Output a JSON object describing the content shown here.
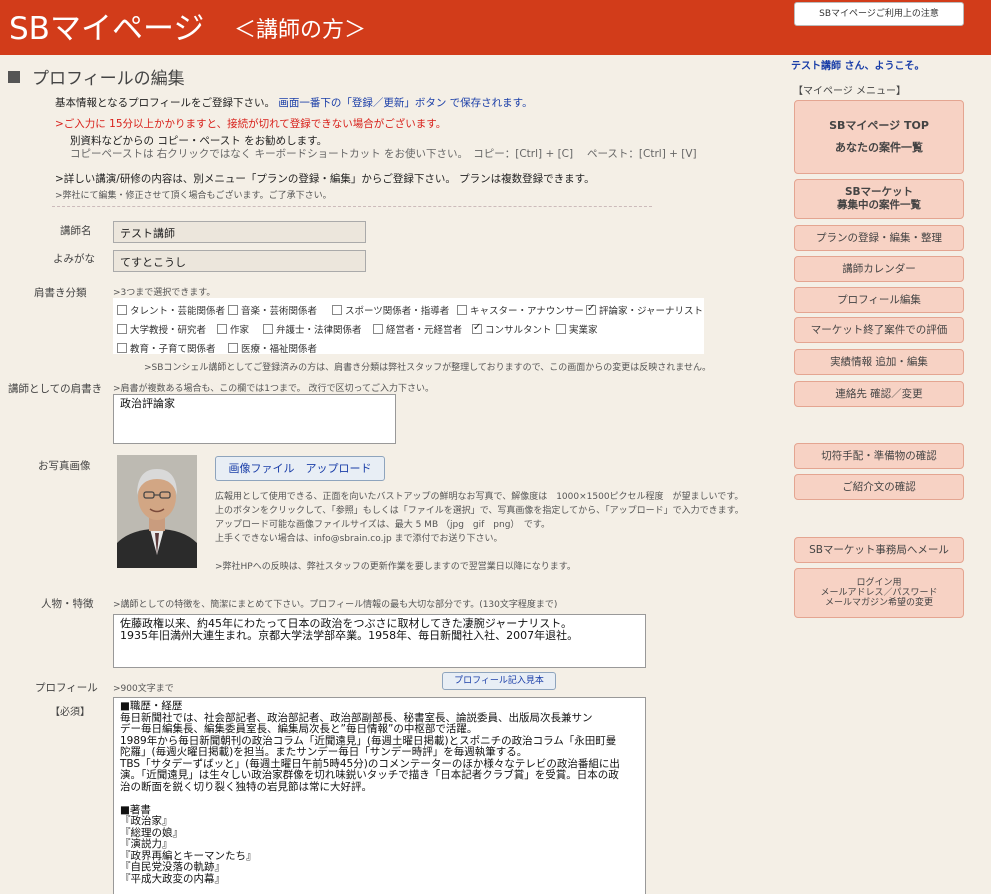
{
  "header": {
    "title": "SBマイページ",
    "subtitle": "＜講師の方＞",
    "notice_button": "SBマイページご利用上の注意"
  },
  "page": {
    "heading": "プロフィールの編集",
    "intro_black": "基本情報となるプロフィールをご登録下さい。",
    "intro_blue": "画面一番下の「登録／更新」ボタン で保存されます。",
    "warning": ">ご入力に 15分以上かかりますと、接続が切れて登録できない場合がございます。",
    "copy_tip1": "別資料などからの コピー・ペースト をお勧めします。",
    "copy_tip2": "コピーペーストは 右クリックではなく キーボードショートカット をお使い下さい。　コピー：[Ctrl] + [C]　 ペースト：[Ctrl] + [V]",
    "plan_note": ">詳しい講演/研修の内容は、別メニュー「プランの登録・編集」からご登録下さい。 プランは複数登録できます。",
    "edit_note": ">弊社にて編集・修正させて頂く場合もございます。ご了承下さい。"
  },
  "form": {
    "name_label": "講師名",
    "name_value": "テスト講師",
    "kana_label": "よみがな",
    "kana_value": "てすとこうし",
    "category_label": "肩書き分類",
    "category_hint": ">3つまで選択できます。",
    "categories": [
      {
        "label": "タレント・芸能関係者",
        "checked": false
      },
      {
        "label": "音楽・芸術関係者",
        "checked": false
      },
      {
        "label": "スポーツ関係者・指導者",
        "checked": false
      },
      {
        "label": "キャスター・アナウンサー",
        "checked": false
      },
      {
        "label": "評論家・ジャーナリスト",
        "checked": true
      },
      {
        "label": "大学教授・研究者",
        "checked": false
      },
      {
        "label": "作家",
        "checked": false
      },
      {
        "label": "弁護士・法律関係者",
        "checked": false
      },
      {
        "label": "経営者・元経営者",
        "checked": false
      },
      {
        "label": "コンサルタント",
        "checked": true
      },
      {
        "label": "実業家",
        "checked": false
      },
      {
        "label": "教育・子育て関係者",
        "checked": false
      },
      {
        "label": "医療・福祉関係者",
        "checked": false
      }
    ],
    "category_note": ">SBコンシェル講師としてご登録済みの方は、肩書き分類は弊社スタッフが整理しておりますので、この画面からの変更は反映されません。",
    "position_label": "講師としての肩書き",
    "position_hint": ">肩書が複数ある場合も、この欄では1つまで。 改行で区切ってご入力下さい。",
    "position_value": "政治評論家",
    "photo_label": "お写真画像",
    "upload_button": "画像ファイル　アップロード",
    "photo_desc1": "広報用として使用できる、正面を向いたバストアップの鮮明なお写真で、解像度は　1000×1500ピクセル程度　が望ましいです。",
    "photo_desc2": "上のボタンをクリックして、「参照」もしくは「ファイルを選択」で、写真画像を指定してから、「アップロード」で入力できます。",
    "photo_desc3": "アップロード可能な画像ファイルサイズは、最大 5 MB （jpg　gif　png）　です。",
    "photo_desc4": "上手くできない場合は、info@sbrain.co.jp まで添付でお送り下さい。",
    "photo_desc5": ">弊社HPへの反映は、弊社スタッフの更新作業を要しますので翌営業日以降になります。",
    "feature_label": "人物・特徴",
    "feature_hint": ">講師としての特徴を、簡潔にまとめて下さい。プロフィール情報の最も大切な部分です。(130文字程度まで)",
    "feature_value1": "佐藤政権以来、約45年にわたって日本の政治をつぶさに取材してきた凄腕ジャーナリスト。",
    "feature_value2": "1935年旧満州大連生まれ。京都大学法学部卒業。1958年、毎日新聞社入社、2007年退社。",
    "profile_label": "プロフィール",
    "profile_required": "【必須】",
    "profile_hint": ">900文字まで",
    "profile_sample_button": "プロフィール記入見本",
    "profile_lines": [
      "■職歴・経歴",
      "毎日新聞社では、社会部記者、政治部記者、政治部副部長、秘書室長、論説委員、出版局次長兼サン",
      "デー毎日編集長、編集委員室長、編集局次長と”毎日情報”の中枢部で活躍。",
      "1989年から毎日新聞朝刊の政治コラム「近聞遠見」(毎週土曜日掲載)とスポニチの政治コラム「永田町曼",
      "陀羅」(毎週火曜日掲載)を担当。またサンデー毎日「サンデー時評」を毎週執筆する。",
      "TBS「サタデーずばッと」(毎週土曜日午前5時45分)のコメンテーターのほか様々なテレビの政治番組に出",
      "演。「近聞遠見」は生々しい政治家群像を切れ味鋭いタッチで描き「日本記者クラブ賞」を受賞。日本の政",
      "治の断面を鋭く切り裂く独特の岩見節は常に大好評。",
      "",
      "■著書",
      "『政治家』",
      "『総理の娘』",
      "『演説力』",
      "『政界再編とキーマンたち』",
      "『自民党没落の軌跡』",
      "『平成大政変の内幕』"
    ]
  },
  "sidebar": {
    "welcome": "テスト講師 さん、ようこそ。",
    "menu_heading": "【マイページ メニュー】",
    "top_line1": "SBマイページ TOP",
    "top_line2": "あなたの案件一覧",
    "market_line1": "SBマーケット",
    "market_line2": "募集中の案件一覧",
    "items": [
      "プランの登録・編集・整理",
      "講師カレンダー",
      "プロフィール編集",
      "マーケット終了案件での評価",
      "実績情報 追加・編集",
      "連絡先 確認／変更"
    ],
    "items2": [
      "切符手配・準備物の確認",
      "ご紹介文の確認"
    ],
    "office_mail": "SBマーケット事務局へメール",
    "login_line1": "ログイン用",
    "login_line2": "メールアドレス／パスワード",
    "login_line3": "メールマガジン希望の変更"
  },
  "colors": {
    "header_bg": "#d23c1a",
    "page_bg": "#f4efe6",
    "side_button": "#f7d2c4",
    "link_blue": "#1a3ea8",
    "warning_red": "#d8201a"
  }
}
